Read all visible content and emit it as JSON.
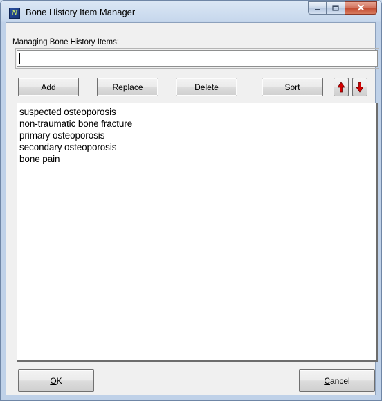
{
  "window": {
    "title": "Bone History Item Manager",
    "app_icon_glyph": "N",
    "close_glyph": "✕",
    "accent": "#2a4f9e"
  },
  "form": {
    "managing_label": "Managing Bone History Items:",
    "entry_value": ""
  },
  "toolbar": {
    "add_prefix": "",
    "add_u": "A",
    "add_rest": "dd",
    "replace_prefix": "",
    "replace_u": "R",
    "replace_rest": "eplace",
    "delete_prefix": "Dele",
    "delete_u": "t",
    "delete_rest": "e",
    "sort_prefix": "",
    "sort_u": "S",
    "sort_rest": "ort",
    "move_up_icon": "arrow-up-icon",
    "move_down_icon": "arrow-down-icon"
  },
  "list": {
    "items": [
      "suspected osteoporosis",
      "non-traumatic bone fracture",
      "primary osteoporosis",
      "secondary osteoporosis",
      "bone pain"
    ]
  },
  "footer": {
    "ok_u": "O",
    "ok_rest": "K",
    "cancel_u": "C",
    "cancel_rest": "ancel"
  }
}
